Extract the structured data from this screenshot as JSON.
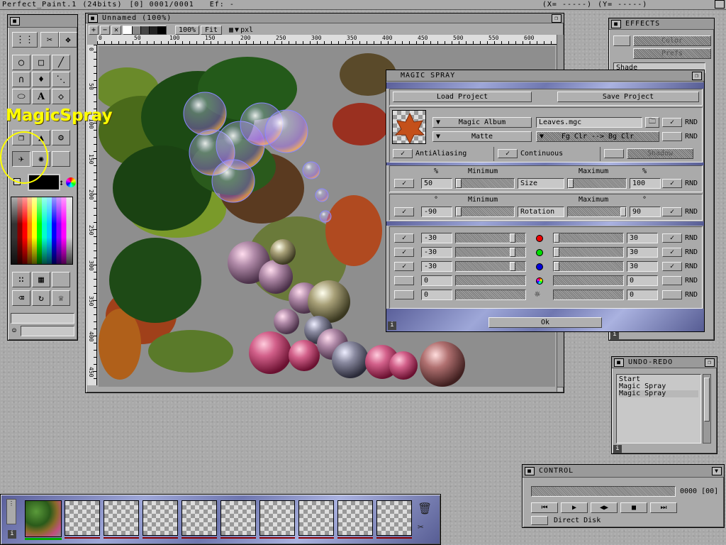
{
  "screen": {
    "title": "Perfect_Paint.1",
    "depth": "(24bits)",
    "frame": "[0] 0001/0001",
    "ef": "Ef: -",
    "coord_x": "(X= -----)",
    "coord_y": "(Y= -----)"
  },
  "overlay": {
    "tool_label": "MagicSpray"
  },
  "canvas_window": {
    "title": "Unnamed (100%)",
    "toolbar": {
      "plus": "+",
      "minus": "−",
      "cross": "✕",
      "zoom": "100%",
      "fit": "Fit",
      "unit": "pxl"
    },
    "ruler_h": [
      "0",
      "50",
      "100",
      "150",
      "200",
      "250",
      "300",
      "350",
      "400",
      "450",
      "500",
      "550",
      "600"
    ],
    "ruler_v": [
      "0",
      "50",
      "100",
      "150",
      "200",
      "250",
      "300",
      "350",
      "400",
      "450"
    ]
  },
  "magic_spray": {
    "title": "MAGIC SPRAY",
    "load": "Load Project",
    "save": "Save Project",
    "magic_album": "Magic Album",
    "album_file": "Leaves.mgc",
    "matte": "Matte",
    "color_mode": "Fg Clr --> Bg Clr",
    "rnd": "RND",
    "antialiasing": "AntiAliasing",
    "continuous": "Continuous",
    "shadow": "Shadow",
    "size": {
      "percent": "%",
      "minimum": "Minimum",
      "maximum": "Maximum",
      "label": "Size",
      "min": "50",
      "max": "100"
    },
    "rotation": {
      "degree": "°",
      "minimum": "Minimum",
      "maximum": "Maximum",
      "label": "Rotation",
      "min": "-90",
      "max": "90"
    },
    "color_rows": [
      {
        "min": "-30",
        "max": "30"
      },
      {
        "min": "-30",
        "max": "30"
      },
      {
        "min": "-30",
        "max": "30"
      },
      {
        "min": "0",
        "max": "0"
      },
      {
        "min": "0",
        "max": "0"
      }
    ],
    "ok": "Ok",
    "info": "i"
  },
  "effects": {
    "title": "EFFECTS",
    "items": [
      "Color",
      "Prefs",
      "Shade"
    ]
  },
  "undo_redo": {
    "title": "UNDO-REDO",
    "items": [
      "Start",
      "Magic Spray",
      "Magic Spray"
    ]
  },
  "control": {
    "title": "CONTROL",
    "counter": "0000 [00]",
    "direct_disk": "Direct Disk"
  },
  "colors": {
    "accent_yellow": "#ffff00",
    "window_gray": "#aaaaaa",
    "title_gray": "#9a9a9a"
  }
}
